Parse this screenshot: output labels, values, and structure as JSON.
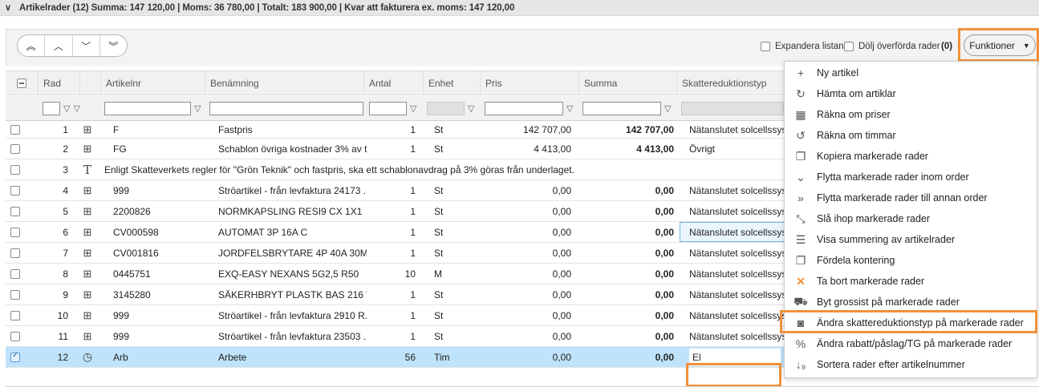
{
  "section": {
    "summary": "Artikelrader  (12) Summa: 147 120,00 | Moms: 36 780,00 | Totalt: 183 900,00 | Kvar att fakturera ex. moms: 147 120,00"
  },
  "toolbar": {
    "nav_icons": [
      "double-chevron-up-icon",
      "chevron-up-icon",
      "chevron-down-icon",
      "double-chevron-down-icon"
    ],
    "expand_label": "Expandera listan",
    "hide_label": "Dölj överförda rader",
    "hidden_count": "(0)",
    "functions_label": "Funktioner"
  },
  "columns": {
    "rad": "Rad",
    "artikelnr": "Artikelnr",
    "benamning": "Benämning",
    "antal": "Antal",
    "enhet": "Enhet",
    "pris": "Pris",
    "summa": "Summa",
    "skattereduktionstyp": "Skattereduktionstyp"
  },
  "rows": [
    {
      "rad": "1",
      "icon": "article-icon",
      "artikelnr": "F",
      "benamning": "Fastpris",
      "antal": "1",
      "enhet": "St",
      "pris": "142 707,00",
      "summa": "142 707,00",
      "typ": "Nätanslutet solcellssystem"
    },
    {
      "rad": "2",
      "icon": "article-icon",
      "artikelnr": "FG",
      "benamning": "Schablon övriga kostnader 3% av t...",
      "antal": "1",
      "enhet": "St",
      "pris": "4 413,00",
      "summa": "4 413,00",
      "typ": "Övrigt"
    },
    {
      "rad": "3",
      "icon": "text-icon",
      "text": "Enligt Skatteverkets regler för \"Grön Teknik\" och fastpris, ska ett schablonavdrag på 3% göras från underlaget."
    },
    {
      "rad": "4",
      "icon": "article-icon",
      "artikelnr": "999",
      "benamning": "Ströartikel - från levfaktura 24173 ...",
      "antal": "1",
      "enhet": "St",
      "pris": "0,00",
      "summa": "0,00",
      "typ": "Nätanslutet solcellssystem"
    },
    {
      "rad": "5",
      "icon": "article-icon",
      "artikelnr": "2200826",
      "benamning": "NORMKAPSLING RESI9 CX 1X1",
      "antal": "1",
      "enhet": "St",
      "pris": "0,00",
      "summa": "0,00",
      "typ": "Nätanslutet solcellssystem"
    },
    {
      "rad": "6",
      "icon": "article-icon",
      "artikelnr": "CV000598",
      "benamning": "AUTOMAT 3P 16A C",
      "antal": "1",
      "enhet": "St",
      "pris": "0,00",
      "summa": "0,00",
      "typ": "Nätanslutet solcellssystem"
    },
    {
      "rad": "7",
      "icon": "article-icon",
      "artikelnr": "CV001816",
      "benamning": "JORDFELSBRYTARE 4P 40A 30MA",
      "antal": "1",
      "enhet": "St",
      "pris": "0,00",
      "summa": "0,00",
      "typ": "Nätanslutet solcellssystem"
    },
    {
      "rad": "8",
      "icon": "article-icon",
      "artikelnr": "0445751",
      "benamning": "EXQ-EASY NEXANS 5G2,5 R50",
      "antal": "10",
      "enhet": "M",
      "pris": "0,00",
      "summa": "0,00",
      "typ": "Nätanslutet solcellssystem"
    },
    {
      "rad": "9",
      "icon": "article-icon",
      "artikelnr": "3145280",
      "benamning": "SÄKERHBRYT PLASTK BAS 216 W ...",
      "antal": "1",
      "enhet": "St",
      "pris": "0,00",
      "summa": "0,00",
      "typ": "Nätanslutet solcellssystem"
    },
    {
      "rad": "10",
      "icon": "article-icon",
      "artikelnr": "999",
      "benamning": "Ströartikel - från levfaktura 2910 R...",
      "antal": "1",
      "enhet": "St",
      "pris": "0,00",
      "summa": "0,00",
      "typ": "Nätanslutet solcellssystem"
    },
    {
      "rad": "11",
      "icon": "article-icon",
      "artikelnr": "999",
      "benamning": "Ströartikel - från levfaktura 23503 ...",
      "antal": "1",
      "enhet": "St",
      "pris": "0,00",
      "summa": "0,00",
      "typ": "Nätanslutet solcellssystem"
    },
    {
      "rad": "12",
      "icon": "clock-icon",
      "artikelnr": "Arb",
      "benamning": "Arbete",
      "antal": "56",
      "enhet": "Tim",
      "pris": "0,00",
      "summa": "0,00",
      "typ": "El",
      "selected": true
    }
  ],
  "menu": {
    "items": [
      {
        "icon": "plus-icon",
        "label": "Ny artikel"
      },
      {
        "icon": "refresh-icon",
        "label": "Hämta om artiklar"
      },
      {
        "icon": "calculator-icon",
        "label": "Räkna om priser"
      },
      {
        "icon": "history-icon",
        "label": "Räkna om timmar"
      },
      {
        "icon": "copy-icon",
        "label": "Kopiera markerade rader"
      },
      {
        "icon": "chevron-down-icon",
        "label": "Flytta markerade rader inom order"
      },
      {
        "icon": "double-chevron-right-icon",
        "label": "Flytta markerade rader till annan order"
      },
      {
        "icon": "merge-icon",
        "label": "Slå ihop markerade rader"
      },
      {
        "icon": "list-icon",
        "label": "Visa summering av artikelrader"
      },
      {
        "icon": "copy-icon",
        "label": "Fördela kontering"
      },
      {
        "icon": "delete-x-icon",
        "label": "Ta bort markerade rader"
      },
      {
        "icon": "truck-icon",
        "label": "Byt grossist på markerade rader"
      },
      {
        "icon": "money-icon",
        "label": "Ändra skattereduktionstyp på markerade rader"
      },
      {
        "icon": "percent-icon",
        "label": "Ändra rabatt/påslag/TG på markerade rader"
      },
      {
        "icon": "sort-numeric-icon",
        "label": "Sortera rader efter artikelnummer"
      }
    ]
  },
  "colors": {
    "highlight": "#f0913a",
    "selected_row": "#bfe3fb"
  }
}
